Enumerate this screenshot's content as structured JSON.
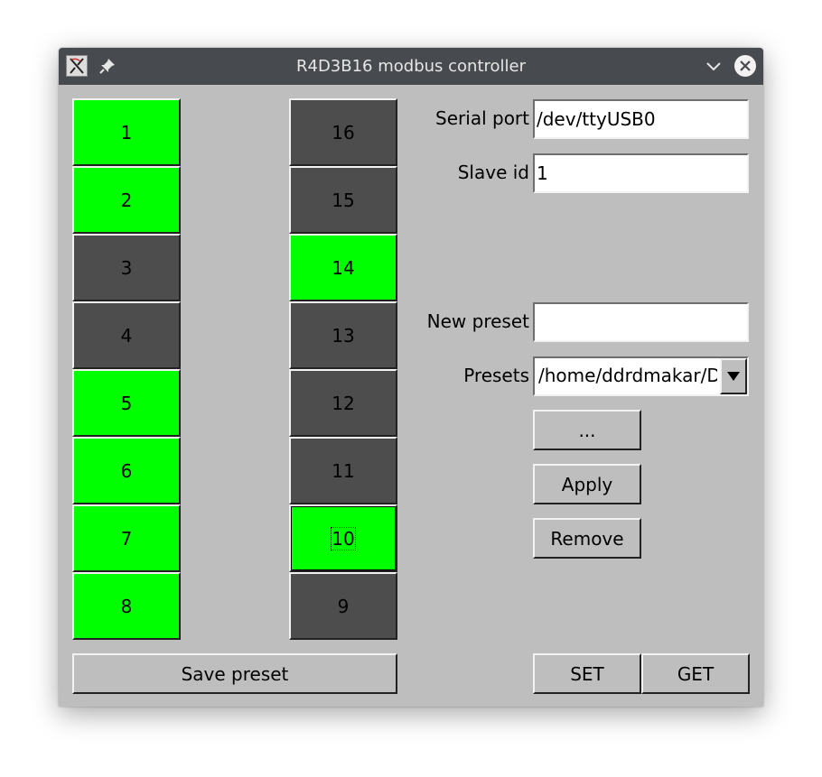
{
  "window": {
    "title": "R4D3B16 modbus controller"
  },
  "icons": {
    "app": "app-icon",
    "pin": "pin-icon",
    "minimize": "chevron-down-icon",
    "close": "close-icon"
  },
  "colors": {
    "relay_on": "#00ff00",
    "relay_off": "#4d4d4d",
    "background": "#bebebe",
    "titlebar": "#474a4f"
  },
  "relays_left": [
    {
      "label": "1",
      "on": true
    },
    {
      "label": "2",
      "on": true
    },
    {
      "label": "3",
      "on": false
    },
    {
      "label": "4",
      "on": false
    },
    {
      "label": "5",
      "on": true
    },
    {
      "label": "6",
      "on": true
    },
    {
      "label": "7",
      "on": true
    },
    {
      "label": "8",
      "on": true
    }
  ],
  "relays_right": [
    {
      "label": "16",
      "on": false
    },
    {
      "label": "15",
      "on": false
    },
    {
      "label": "14",
      "on": true
    },
    {
      "label": "13",
      "on": false
    },
    {
      "label": "12",
      "on": false
    },
    {
      "label": "11",
      "on": false
    },
    {
      "label": "10",
      "on": true
    },
    {
      "label": "9",
      "on": false
    }
  ],
  "form": {
    "serial_port_label": "Serial port",
    "serial_port_value": "/dev/ttyUSB0",
    "slave_id_label": "Slave id",
    "slave_id_value": "1",
    "new_preset_label": "New preset",
    "new_preset_value": "",
    "presets_label": "Presets",
    "presets_value": "/home/ddrdmakar/Documents/presets"
  },
  "buttons": {
    "browse": "...",
    "apply": "Apply",
    "remove": "Remove",
    "save_preset": "Save preset",
    "set": "SET",
    "get": "GET"
  }
}
